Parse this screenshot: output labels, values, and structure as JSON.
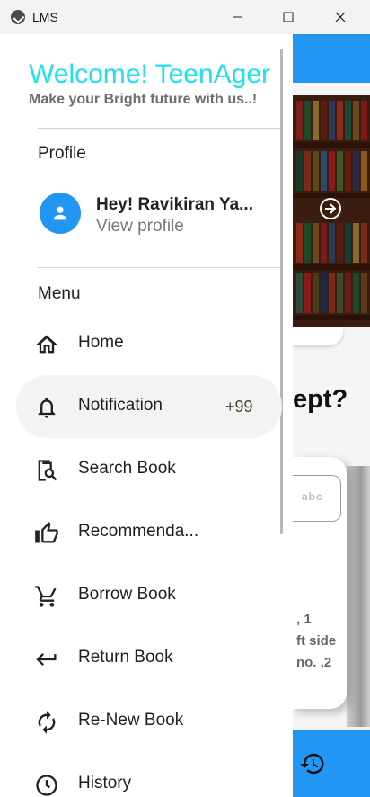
{
  "window": {
    "title": "LMS"
  },
  "drawer": {
    "welcome": "Welcome! TeenAger",
    "tagline": "Make your Bright future with us..!",
    "profile_section": "Profile",
    "profile": {
      "name": "Hey! Ravikiran Ya...",
      "link": "View profile"
    },
    "menu_section": "Menu",
    "items": [
      {
        "label": "Home",
        "icon": "home-icon"
      },
      {
        "label": "Notification",
        "icon": "bell-icon",
        "badge": "+99",
        "active": true
      },
      {
        "label": "Search Book",
        "icon": "search-book-icon"
      },
      {
        "label": "Recommenda...",
        "icon": "thumbs-up-icon"
      },
      {
        "label": "Borrow Book",
        "icon": "cart-icon"
      },
      {
        "label": "Return Book",
        "icon": "return-arrow-icon"
      },
      {
        "label": "Re-New Book",
        "icon": "refresh-icon"
      },
      {
        "label": "History",
        "icon": "history-icon"
      }
    ]
  },
  "background": {
    "quiz_heading": "ept?",
    "input_label": "abc",
    "lines": [
      ", 1",
      "ft side",
      "no. ,2"
    ]
  },
  "colors": {
    "accent": "#2196f3",
    "welcome": "#1ee0f0",
    "active_item_bg": "#f3f3f3"
  }
}
